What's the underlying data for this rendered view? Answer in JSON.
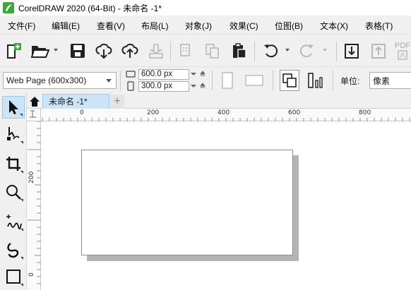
{
  "window": {
    "title": "CorelDRAW 2020 (64-Bit) - 未命名 -1*"
  },
  "menu": {
    "items": [
      "文件(F)",
      "编辑(E)",
      "查看(V)",
      "布局(L)",
      "对象(J)",
      "效果(C)",
      "位图(B)",
      "文本(X)",
      "表格(T)"
    ]
  },
  "toolbar": {
    "partial_label": "PDF"
  },
  "properties": {
    "page_preset": "Web Page (600x300)",
    "width_value": "600.0 px",
    "height_value": "300.0 px",
    "units_label": "单位:",
    "units_value": "像素"
  },
  "document_tabs": {
    "active_tab": "未命名 -1*",
    "add_tab_symbol": "+"
  },
  "rulers": {
    "horizontal_labels": [
      "0",
      "200",
      "400",
      "600",
      "800"
    ],
    "vertical_labels": [
      "200",
      "0"
    ],
    "unit_marker": "px"
  },
  "colors": {
    "chrome_bg": "#f0f0f0",
    "active_blue": "#cce4f7",
    "active_border": "#99c9ef",
    "page_shadow": "#b4b4b4",
    "logo_green": "#3aaa35"
  }
}
